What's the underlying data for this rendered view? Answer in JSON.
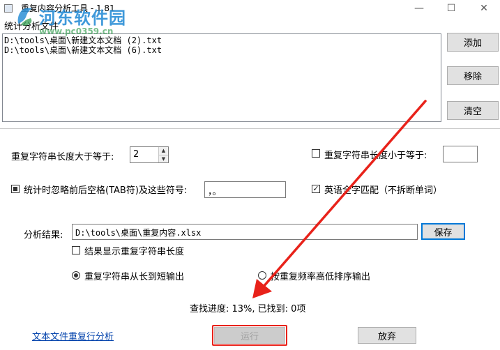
{
  "window": {
    "title": "重复内容分析工具 - 1.81",
    "minimize_glyph": "—",
    "maximize_glyph": "☐",
    "close_glyph": "✕"
  },
  "watermark": {
    "site_name": "河东软件园",
    "url": "www.pc0359.cn"
  },
  "files_group": {
    "label": "统计分析文件",
    "files": [
      "D:\\tools\\桌面\\新建文本文档 (2).txt",
      "D:\\tools\\桌面\\新建文本文档 (6).txt"
    ],
    "add_label": "添加",
    "remove_label": "移除",
    "clear_label": "清空"
  },
  "options": {
    "min_length_label": "重复字符串长度大于等于:",
    "min_length_value": "2",
    "max_length_checkbox_label": "重复字符串长度小于等于:",
    "max_length_checked": false,
    "max_length_value": "",
    "ignore_spaces_label": "统计时忽略前后空格(TAB符)及这些符号:",
    "ignore_spaces_checked": true,
    "ignore_symbols_value": "，。",
    "whole_word_label": "英语全字匹配（不拆断单词）",
    "whole_word_checked": true
  },
  "result": {
    "label": "分析结果:",
    "path_value": "D:\\tools\\桌面\\重复内容.xlsx",
    "save_label": "保存",
    "show_length_label": "结果显示重复字符串长度",
    "show_length_checked": false,
    "sort_by_length_label": "重复字符串从长到短输出",
    "sort_by_frequency_label": "按重复频率高低排序输出",
    "selected_sort": "length"
  },
  "status": {
    "progress_text": "查找进度: 13%, 已找到: 0项",
    "progress_percent": 13,
    "found_count": 0
  },
  "footer": {
    "link_label": "文本文件重复行分析",
    "run_label": "运行",
    "run_enabled": false,
    "abandon_label": "放弃"
  },
  "colors": {
    "annotation_red": "#e8221a",
    "link_blue": "#0645ad",
    "watermark_blue": "#2b8fd6",
    "focus_blue": "#0078d7"
  },
  "icons": {
    "app": "app-icon",
    "spin_up": "arrow-up-icon",
    "spin_down": "arrow-down-icon",
    "watermark_logo": "site-logo-icon"
  }
}
